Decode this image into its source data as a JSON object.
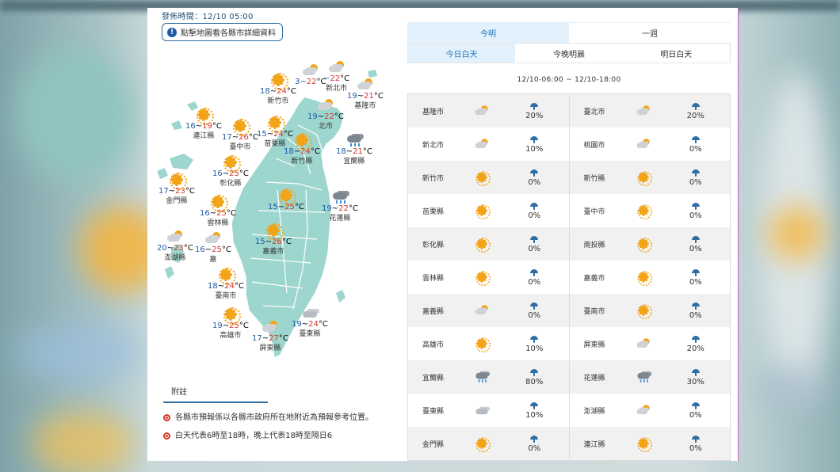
{
  "header": {
    "publish_time": "發佈時間：12/10 05:00",
    "map_hint": "點擊地圖看各縣市詳細資料"
  },
  "map_cities": [
    {
      "key": "hsinchu-city",
      "name": "新竹市",
      "lo": "18",
      "hi": "24",
      "icon": "sun"
    },
    {
      "key": "taipei",
      "name": "",
      "lo": "",
      "hi": "22",
      "icon": "pcloud",
      "prefix": "3~"
    },
    {
      "key": "new-taipei",
      "name": "新北市",
      "lo": "",
      "hi": "22",
      "icon": "pcloud",
      "prefix": "~"
    },
    {
      "key": "keelung",
      "name": "基隆市",
      "lo": "19",
      "hi": "21",
      "icon": "pcloud"
    },
    {
      "key": "taoyuan",
      "name": "北市",
      "lo": "19",
      "hi": "22",
      "icon": "pcloud"
    },
    {
      "key": "lienchiang",
      "name": "連江縣",
      "lo": "16",
      "hi": "19",
      "icon": "sun"
    },
    {
      "key": "taichung",
      "name": "臺中市",
      "lo": "17",
      "hi": "26",
      "icon": "sun"
    },
    {
      "key": "miaoli",
      "name": "苗栗縣",
      "lo": "15",
      "hi": "24",
      "icon": "sun"
    },
    {
      "key": "hsinchu-county",
      "name": "新竹縣",
      "lo": "18",
      "hi": "24",
      "icon": "sun"
    },
    {
      "key": "yilan",
      "name": "宜蘭縣",
      "lo": "18",
      "hi": "21",
      "icon": "rain"
    },
    {
      "key": "changhua",
      "name": "彰化縣",
      "lo": "16",
      "hi": "25",
      "icon": "sun"
    },
    {
      "key": "kinmen",
      "name": "金門縣",
      "lo": "17",
      "hi": "23",
      "icon": "sun"
    },
    {
      "key": "nantou",
      "name": "",
      "lo": "15",
      "hi": "25",
      "icon": "sun"
    },
    {
      "key": "hualien",
      "name": "花蓮縣",
      "lo": "19",
      "hi": "22",
      "icon": "rain"
    },
    {
      "key": "yunlin",
      "name": "雲林縣",
      "lo": "16",
      "hi": "25",
      "icon": "sun"
    },
    {
      "key": "penghu",
      "name": "澎湖縣",
      "lo": "20",
      "hi": "23",
      "icon": "pcloud"
    },
    {
      "key": "chiayi-county",
      "name": "嘉",
      "lo": "16",
      "hi": "25",
      "icon": "pcloud"
    },
    {
      "key": "chiayi-city",
      "name": "嘉義市",
      "lo": "15",
      "hi": "26",
      "icon": "sun"
    },
    {
      "key": "tainan",
      "name": "臺南市",
      "lo": "18",
      "hi": "24",
      "icon": "sun"
    },
    {
      "key": "kaohsiung",
      "name": "高雄市",
      "lo": "19",
      "hi": "25",
      "icon": "sun"
    },
    {
      "key": "pingtung",
      "name": "屏東縣",
      "lo": "17",
      "hi": "27",
      "icon": "pcloud"
    },
    {
      "key": "taitung",
      "name": "臺東縣",
      "lo": "19",
      "hi": "24",
      "icon": "cloud"
    }
  ],
  "notes": {
    "title": "附註",
    "items": [
      "各縣市預報係以各縣市政府所在地附近為預報參考位置。",
      "白天代表6時至18時，晚上代表18時至隔日6"
    ]
  },
  "forecast": {
    "tabs": [
      "今明",
      "一週"
    ],
    "sub_tabs": [
      "今日白天",
      "今晚明晨",
      "明日白天"
    ],
    "period": "12/10-06:00 ~ 12/10-18:00",
    "rows": [
      [
        {
          "name": "基隆市",
          "icon": "pcloud",
          "pop": "20%"
        },
        {
          "name": "臺北市",
          "icon": "pcloud",
          "pop": "20%"
        }
      ],
      [
        {
          "name": "新北市",
          "icon": "pcloud",
          "pop": "10%"
        },
        {
          "name": "桃園市",
          "icon": "pcloud",
          "pop": "0%"
        }
      ],
      [
        {
          "name": "新竹市",
          "icon": "sun",
          "pop": "0%"
        },
        {
          "name": "新竹縣",
          "icon": "sun",
          "pop": "0%"
        }
      ],
      [
        {
          "name": "苗栗縣",
          "icon": "sun",
          "pop": "0%"
        },
        {
          "name": "臺中市",
          "icon": "sun",
          "pop": "0%"
        }
      ],
      [
        {
          "name": "彰化縣",
          "icon": "sun",
          "pop": "0%"
        },
        {
          "name": "南投縣",
          "icon": "sun",
          "pop": "0%"
        }
      ],
      [
        {
          "name": "雲林縣",
          "icon": "sun",
          "pop": "0%"
        },
        {
          "name": "嘉義市",
          "icon": "sun",
          "pop": "0%"
        }
      ],
      [
        {
          "name": "嘉義縣",
          "icon": "pcloud",
          "pop": "0%"
        },
        {
          "name": "臺南市",
          "icon": "sun",
          "pop": "0%"
        }
      ],
      [
        {
          "name": "高雄市",
          "icon": "sun",
          "pop": "10%"
        },
        {
          "name": "屏東縣",
          "icon": "pcloud",
          "pop": "20%"
        }
      ],
      [
        {
          "name": "宜蘭縣",
          "icon": "rain",
          "pop": "80%"
        },
        {
          "name": "花蓮縣",
          "icon": "rain",
          "pop": "30%"
        }
      ],
      [
        {
          "name": "臺東縣",
          "icon": "cloud",
          "pop": "10%"
        },
        {
          "name": "澎湖縣",
          "icon": "pcloud",
          "pop": "0%"
        }
      ],
      [
        {
          "name": "金門縣",
          "icon": "sun",
          "pop": "0%"
        },
        {
          "name": "連江縣",
          "icon": "sun",
          "pop": "0%"
        }
      ]
    ]
  }
}
